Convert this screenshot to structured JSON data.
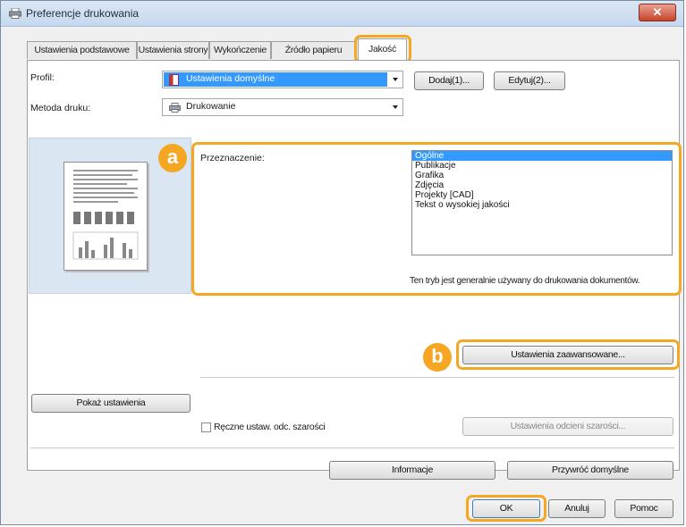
{
  "window": {
    "title": "Preferencje drukowania",
    "close_label": "✕"
  },
  "tabs": [
    {
      "label": "Ustawienia podstawowe"
    },
    {
      "label": "Ustawienia strony"
    },
    {
      "label": "Wykończenie"
    },
    {
      "label": "Źródło papieru"
    },
    {
      "label": "Jakość",
      "active": true
    }
  ],
  "profile": {
    "label": "Profil:",
    "value": "Ustawienia domyślne",
    "add_button": "Dodaj(1)...",
    "edit_button": "Edytuj(2)..."
  },
  "print_method": {
    "label": "Metoda druku:",
    "value": "Drukowanie"
  },
  "purpose": {
    "label": "Przeznaczenie:",
    "options": [
      "Ogólne",
      "Publikacje",
      "Grafika",
      "Zdjęcia",
      "Projekty [CAD]",
      "Tekst o wysokiej jakości"
    ],
    "selected_index": 0,
    "description": "Ten tryb jest generalnie używany do drukowania dokumentów."
  },
  "markers": {
    "a": "a",
    "b": "b"
  },
  "advanced_button": "Ustawienia zaawansowane...",
  "show_settings_button": "Pokaż ustawienia",
  "grayscale": {
    "checkbox_label": "Ręczne ustaw. odc. szarości",
    "checked": false,
    "button": "Ustawienia odcieni szarości..."
  },
  "info_button": "Informacje",
  "restore_button": "Przywróć domyślne",
  "footer": {
    "ok": "OK",
    "cancel": "Anuluj",
    "help": "Pomoc"
  },
  "colors": {
    "highlight": "#f5a623",
    "selection": "#3399ff",
    "preview_bg": "#dbe6f3"
  }
}
